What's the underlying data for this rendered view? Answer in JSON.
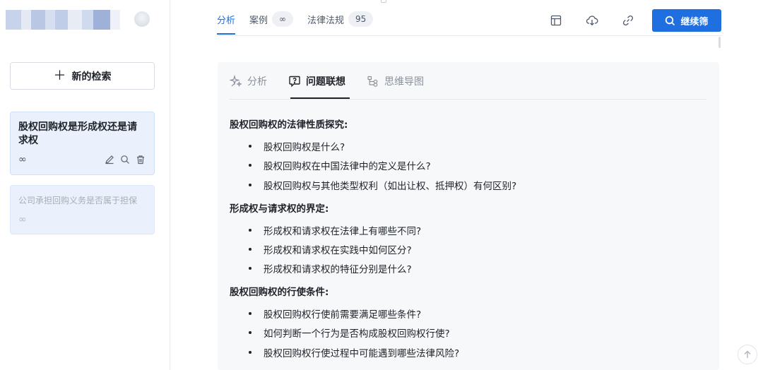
{
  "sidebar": {
    "new_search_label": "新的检索",
    "history": [
      {
        "title": "股权回购权是形成权还是请求权",
        "mode": "∞"
      },
      {
        "title": "公司承担回购义务是否属于担保",
        "mode": "∞"
      }
    ]
  },
  "header": {
    "tabs": [
      {
        "label": "分析"
      },
      {
        "label": "案例",
        "badge": "∞"
      },
      {
        "label": "法律法规",
        "badge": "95"
      }
    ],
    "continue_label": "继续筛"
  },
  "panel": {
    "sub_tabs": [
      {
        "label": "分析"
      },
      {
        "label": "问题联想"
      },
      {
        "label": "思维导图"
      }
    ],
    "sections": [
      {
        "title": "股权回购权的法律性质探究:",
        "items": [
          "股权回购权是什么?",
          "股权回购权在中国法律中的定义是什么?",
          "股权回购权与其他类型权利（如出让权、抵押权）有何区别?"
        ]
      },
      {
        "title": "形成权与请求权的界定:",
        "items": [
          "形成权和请求权在法律上有哪些不同?",
          "形成权和请求权在实践中如何区分?",
          "形成权和请求权的特征分别是什么?"
        ]
      },
      {
        "title": "股权回购权的行使条件:",
        "items": [
          "股权回购权行使前需要满足哪些条件?",
          "如何判断一个行为是否构成股权回购权行使?",
          "股权回购权行使过程中可能遇到哪些法律风险?"
        ]
      }
    ]
  },
  "colors": {
    "accent": "#1f6fe0",
    "card_bg": "#eaf1fc",
    "panel_bg": "#f7f8fa"
  },
  "icons": [
    "avatar",
    "plus-icon",
    "edit-icon",
    "search-icon",
    "trash-icon",
    "table-icon",
    "download-icon",
    "link-icon",
    "sparkle-icon",
    "question-bubble-icon",
    "mindmap-icon",
    "arrow-up-icon"
  ]
}
